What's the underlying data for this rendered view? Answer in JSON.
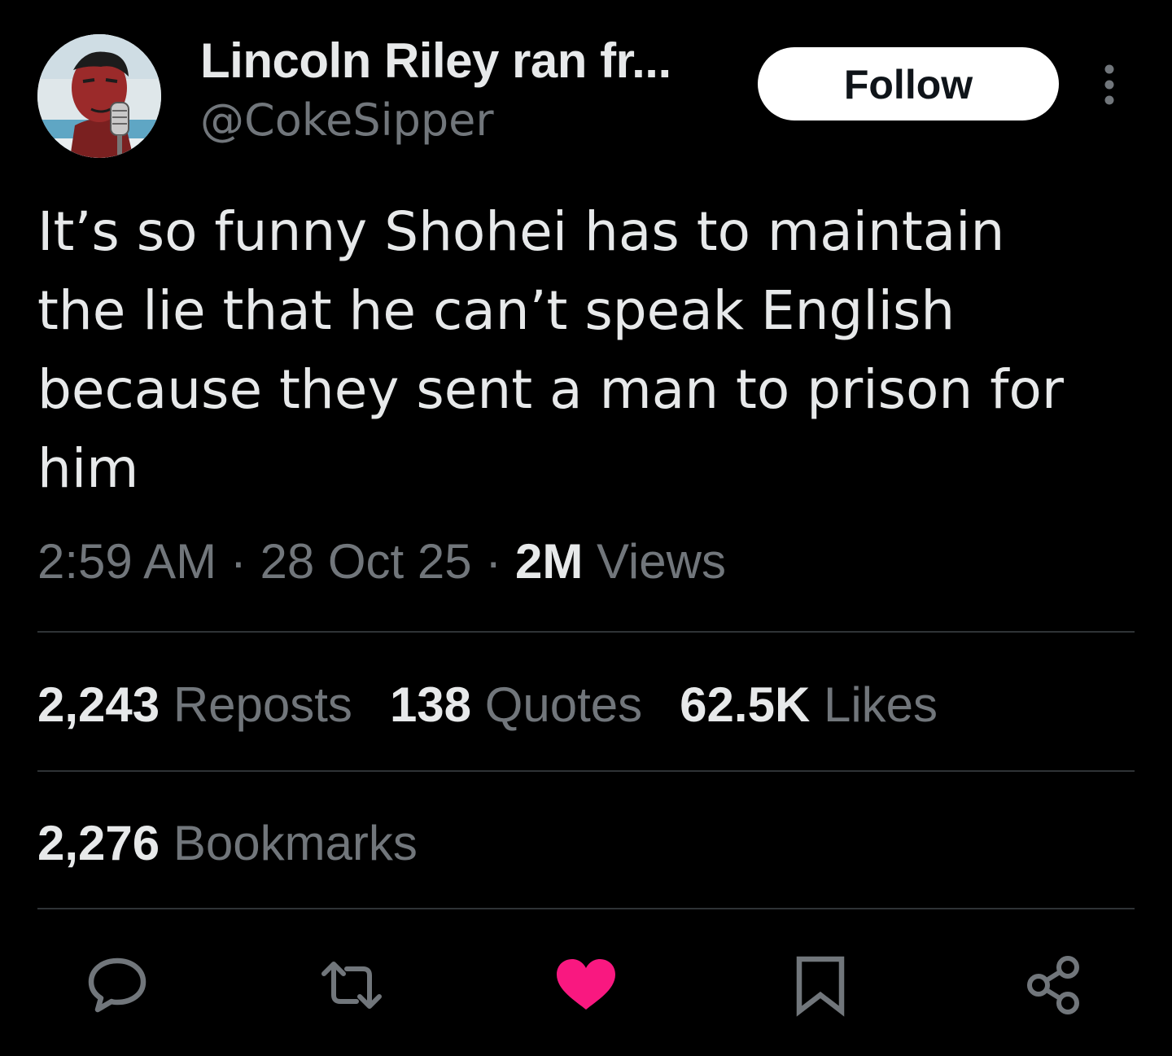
{
  "author": {
    "display_name": "Lincoln Riley ran fr...",
    "handle": "@CokeSipper",
    "avatar_icon": "avatar-person-microphone"
  },
  "header": {
    "follow_label": "Follow",
    "more_icon": "more-vertical-icon"
  },
  "tweet": {
    "text": "It’s so funny Shohei has to maintain\nthe lie that he can’t speak English\nbecause they sent a man to prison for\nhim",
    "time": "2:59 AM",
    "separator": "·",
    "date": "28 Oct 25",
    "views_count": "2M",
    "views_label": "Views"
  },
  "stats": {
    "reposts_count": "2,243",
    "reposts_label": "Reposts",
    "quotes_count": "138",
    "quotes_label": "Quotes",
    "likes_count": "62.5K",
    "likes_label": "Likes",
    "bookmarks_count": "2,276",
    "bookmarks_label": "Bookmarks"
  },
  "actions": {
    "reply_icon": "reply-icon",
    "repost_icon": "repost-icon",
    "like_icon": "heart-icon",
    "like_active": true,
    "bookmark_icon": "bookmark-icon",
    "share_icon": "share-icon"
  },
  "colors": {
    "background": "#000000",
    "primary_text": "#e7e9ea",
    "secondary_text": "#71767b",
    "divider": "#2f3336",
    "like_active": "#f91880",
    "follow_bg": "#ffffff"
  }
}
